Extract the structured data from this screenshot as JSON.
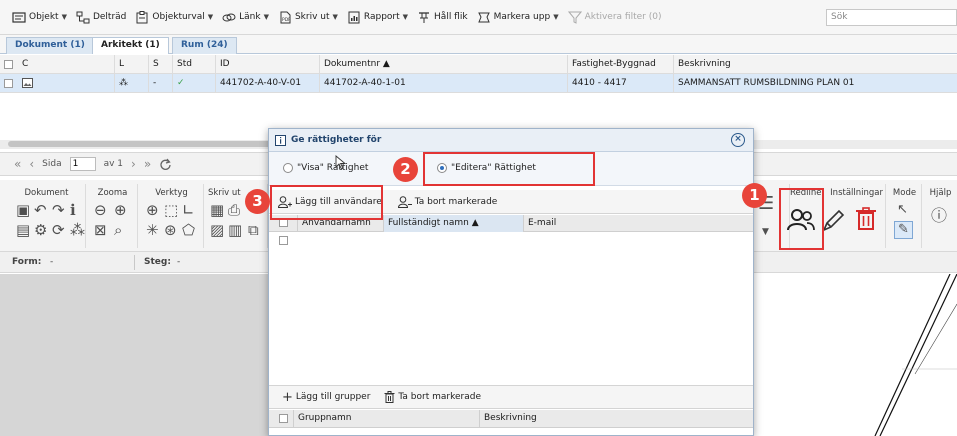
{
  "toolbar": {
    "items": [
      {
        "label": "Objekt",
        "icon": "objekt-icon",
        "caret": true
      },
      {
        "label": "Delträd",
        "icon": "tree-icon",
        "caret": false
      },
      {
        "label": "Objekturval",
        "icon": "clipboard-icon",
        "caret": true
      },
      {
        "label": "Länk",
        "icon": "link-icon",
        "caret": true
      },
      {
        "label": "Skriv ut",
        "icon": "pdf-icon",
        "caret": true
      },
      {
        "label": "Rapport",
        "icon": "report-icon",
        "caret": true
      },
      {
        "label": "Håll flik",
        "icon": "pin-icon",
        "caret": false
      },
      {
        "label": "Markera upp",
        "icon": "markup-icon",
        "caret": true
      },
      {
        "label": "Aktivera filter (0)",
        "icon": "filter-icon",
        "caret": false,
        "disabled": true
      }
    ],
    "search_placeholder": "Sök"
  },
  "tabs": [
    {
      "label": "Dokument (1)",
      "active": false
    },
    {
      "label": "Arkitekt (1)",
      "active": true
    },
    {
      "label": "Rum (24)",
      "active": false
    }
  ],
  "grid": {
    "columns": [
      "C",
      "L",
      "S",
      "Std",
      "ID",
      "Dokumentnr ▲",
      "Fastighet-Byggnad",
      "Beskrivning"
    ],
    "rows": [
      {
        "L": "⁂",
        "S": "-",
        "Std": "✓",
        "ID": "441702-A-40-V-01",
        "Dokumentnr": "441702-A-40-1-01",
        "Fastighet": "4410 - 4417",
        "Beskrivning": "SAMMANSATT RUMSBILDNING PLAN 01"
      }
    ]
  },
  "pager": {
    "page_label": "Sida",
    "page_value": "1",
    "of_label": "av 1"
  },
  "ribbon": {
    "groups": [
      "Dokument",
      "Zooma",
      "Verktyg",
      "Skriv ut",
      "Redline",
      "Inställningar",
      "Mode",
      "Hjälp"
    ]
  },
  "formbar": {
    "form_label": "Form:",
    "form_value": "-",
    "step_label": "Steg:",
    "step_value": "-"
  },
  "dialog": {
    "title": "Ge rättigheter för",
    "radio_view": "\"Visa\" Rättighet",
    "radio_edit": "\"Editera\" Rättighet",
    "add_user": "Lägg till användare",
    "remove_selected_users": "Ta bort markerade",
    "user_columns": [
      "Användarnamn",
      "Fullständigt namn ▲",
      "E-mail"
    ],
    "add_groups": "Lägg till grupper",
    "remove_selected_groups": "Ta bort markerade",
    "group_columns": [
      "Gruppnamn",
      "Beskrivning"
    ]
  },
  "annotations": {
    "badge1": "1",
    "badge2": "2",
    "badge3": "3"
  },
  "colors": {
    "annotation_red": "#e23434",
    "badge_red": "#e8443a",
    "tab_blue": "#2f5f99",
    "selected_row": "#dbe9f8"
  }
}
